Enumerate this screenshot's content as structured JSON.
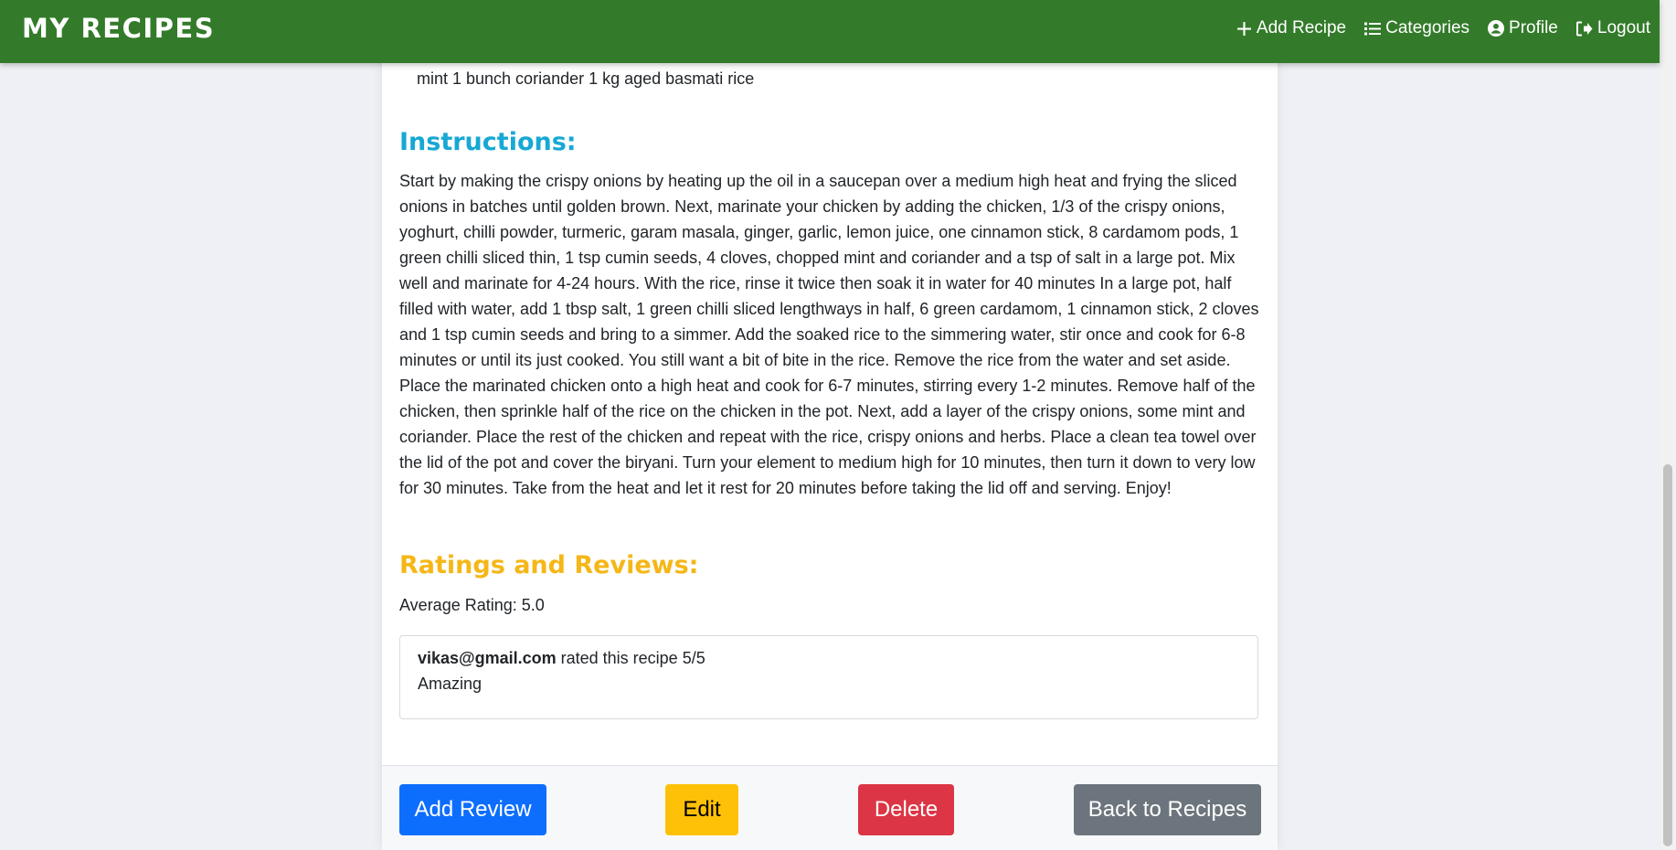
{
  "nav": {
    "brand": "MY RECIPES",
    "links": [
      {
        "label": "Add Recipe",
        "icon": "plus-icon"
      },
      {
        "label": "Categories",
        "icon": "list-icon"
      },
      {
        "label": "Profile",
        "icon": "user-circle-icon"
      },
      {
        "label": "Logout",
        "icon": "logout-icon"
      }
    ]
  },
  "recipe": {
    "ingredients_tail": "mint 1 bunch coriander 1 kg aged basmati rice",
    "instructions_title": "Instructions:",
    "instructions": "Start by making the crispy onions by heating up the oil in a saucepan over a medium high heat and frying the sliced onions in batches until golden brown. Next, marinate your chicken by adding the chicken, 1/3 of the crispy onions, yoghurt, chilli powder, turmeric, garam masala, ginger, garlic, lemon juice, one cinnamon stick, 8 cardamom pods, 1 green chilli sliced thin, 1 tsp cumin seeds, 4 cloves, chopped mint and coriander and a tsp of salt in a large pot. Mix well and marinate for 4-24 hours. With the rice, rinse it twice then soak it in water for 40 minutes In a large pot, half filled with water, add 1 tbsp salt, 1 green chilli sliced lengthways in half, 6 green cardamom, 1 cinnamon stick, 2 cloves and 1 tsp cumin seeds and bring to a simmer. Add the soaked rice to the simmering water, stir once and cook for 6-8 minutes or until its just cooked. You still want a bit of bite in the rice. Remove the rice from the water and set aside. Place the marinated chicken onto a high heat and cook for 6-7 minutes, stirring every 1-2 minutes. Remove half of the chicken, then sprinkle half of the rice on the chicken in the pot. Next, add a layer of the crispy onions, some mint and coriander. Place the rest of the chicken and repeat with the rice, crispy onions and herbs. Place a clean tea towel over the lid of the pot and cover the biryani. Turn your element to medium high for 10 minutes, then turn it down to very low for 30 minutes. Take from the heat and let it rest for 20 minutes before taking the lid off and serving. Enjoy!"
  },
  "ratings": {
    "title": "Ratings and Reviews:",
    "average": "Average Rating: 5.0",
    "reviews": [
      {
        "user": "vikas@gmail.com",
        "rated_text": " rated this recipe 5/5",
        "comment": "Amazing"
      }
    ]
  },
  "actions": {
    "add_review": "Add Review",
    "edit": "Edit",
    "delete": "Delete",
    "back": "Back to Recipes"
  },
  "colors": {
    "navbar": "#337b2a",
    "instructions_heading": "#17a8d4",
    "ratings_heading": "#f5b718",
    "primary": "#0d6efd",
    "warning": "#ffc107",
    "danger": "#dc3545",
    "secondary": "#6c757d"
  }
}
